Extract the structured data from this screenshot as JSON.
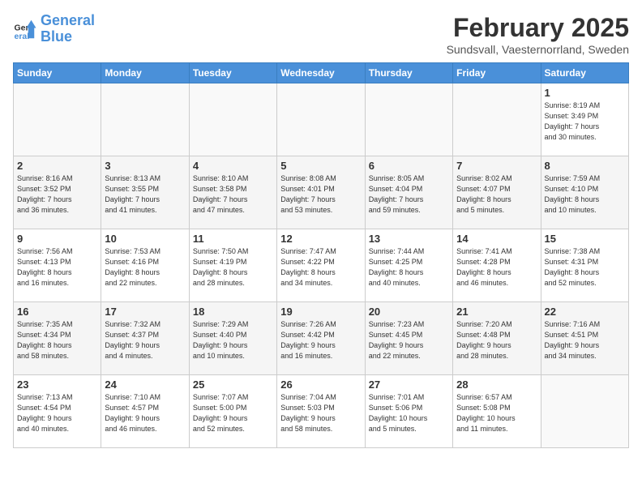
{
  "header": {
    "logo_line1": "General",
    "logo_line2": "Blue",
    "month": "February 2025",
    "location": "Sundsvall, Vaesternorrland, Sweden"
  },
  "days_of_week": [
    "Sunday",
    "Monday",
    "Tuesday",
    "Wednesday",
    "Thursday",
    "Friday",
    "Saturday"
  ],
  "weeks": [
    [
      {
        "day": "",
        "info": ""
      },
      {
        "day": "",
        "info": ""
      },
      {
        "day": "",
        "info": ""
      },
      {
        "day": "",
        "info": ""
      },
      {
        "day": "",
        "info": ""
      },
      {
        "day": "",
        "info": ""
      },
      {
        "day": "1",
        "info": "Sunrise: 8:19 AM\nSunset: 3:49 PM\nDaylight: 7 hours\nand 30 minutes."
      }
    ],
    [
      {
        "day": "2",
        "info": "Sunrise: 8:16 AM\nSunset: 3:52 PM\nDaylight: 7 hours\nand 36 minutes."
      },
      {
        "day": "3",
        "info": "Sunrise: 8:13 AM\nSunset: 3:55 PM\nDaylight: 7 hours\nand 41 minutes."
      },
      {
        "day": "4",
        "info": "Sunrise: 8:10 AM\nSunset: 3:58 PM\nDaylight: 7 hours\nand 47 minutes."
      },
      {
        "day": "5",
        "info": "Sunrise: 8:08 AM\nSunset: 4:01 PM\nDaylight: 7 hours\nand 53 minutes."
      },
      {
        "day": "6",
        "info": "Sunrise: 8:05 AM\nSunset: 4:04 PM\nDaylight: 7 hours\nand 59 minutes."
      },
      {
        "day": "7",
        "info": "Sunrise: 8:02 AM\nSunset: 4:07 PM\nDaylight: 8 hours\nand 5 minutes."
      },
      {
        "day": "8",
        "info": "Sunrise: 7:59 AM\nSunset: 4:10 PM\nDaylight: 8 hours\nand 10 minutes."
      }
    ],
    [
      {
        "day": "9",
        "info": "Sunrise: 7:56 AM\nSunset: 4:13 PM\nDaylight: 8 hours\nand 16 minutes."
      },
      {
        "day": "10",
        "info": "Sunrise: 7:53 AM\nSunset: 4:16 PM\nDaylight: 8 hours\nand 22 minutes."
      },
      {
        "day": "11",
        "info": "Sunrise: 7:50 AM\nSunset: 4:19 PM\nDaylight: 8 hours\nand 28 minutes."
      },
      {
        "day": "12",
        "info": "Sunrise: 7:47 AM\nSunset: 4:22 PM\nDaylight: 8 hours\nand 34 minutes."
      },
      {
        "day": "13",
        "info": "Sunrise: 7:44 AM\nSunset: 4:25 PM\nDaylight: 8 hours\nand 40 minutes."
      },
      {
        "day": "14",
        "info": "Sunrise: 7:41 AM\nSunset: 4:28 PM\nDaylight: 8 hours\nand 46 minutes."
      },
      {
        "day": "15",
        "info": "Sunrise: 7:38 AM\nSunset: 4:31 PM\nDaylight: 8 hours\nand 52 minutes."
      }
    ],
    [
      {
        "day": "16",
        "info": "Sunrise: 7:35 AM\nSunset: 4:34 PM\nDaylight: 8 hours\nand 58 minutes."
      },
      {
        "day": "17",
        "info": "Sunrise: 7:32 AM\nSunset: 4:37 PM\nDaylight: 9 hours\nand 4 minutes."
      },
      {
        "day": "18",
        "info": "Sunrise: 7:29 AM\nSunset: 4:40 PM\nDaylight: 9 hours\nand 10 minutes."
      },
      {
        "day": "19",
        "info": "Sunrise: 7:26 AM\nSunset: 4:42 PM\nDaylight: 9 hours\nand 16 minutes."
      },
      {
        "day": "20",
        "info": "Sunrise: 7:23 AM\nSunset: 4:45 PM\nDaylight: 9 hours\nand 22 minutes."
      },
      {
        "day": "21",
        "info": "Sunrise: 7:20 AM\nSunset: 4:48 PM\nDaylight: 9 hours\nand 28 minutes."
      },
      {
        "day": "22",
        "info": "Sunrise: 7:16 AM\nSunset: 4:51 PM\nDaylight: 9 hours\nand 34 minutes."
      }
    ],
    [
      {
        "day": "23",
        "info": "Sunrise: 7:13 AM\nSunset: 4:54 PM\nDaylight: 9 hours\nand 40 minutes."
      },
      {
        "day": "24",
        "info": "Sunrise: 7:10 AM\nSunset: 4:57 PM\nDaylight: 9 hours\nand 46 minutes."
      },
      {
        "day": "25",
        "info": "Sunrise: 7:07 AM\nSunset: 5:00 PM\nDaylight: 9 hours\nand 52 minutes."
      },
      {
        "day": "26",
        "info": "Sunrise: 7:04 AM\nSunset: 5:03 PM\nDaylight: 9 hours\nand 58 minutes."
      },
      {
        "day": "27",
        "info": "Sunrise: 7:01 AM\nSunset: 5:06 PM\nDaylight: 10 hours\nand 5 minutes."
      },
      {
        "day": "28",
        "info": "Sunrise: 6:57 AM\nSunset: 5:08 PM\nDaylight: 10 hours\nand 11 minutes."
      },
      {
        "day": "",
        "info": ""
      }
    ]
  ]
}
